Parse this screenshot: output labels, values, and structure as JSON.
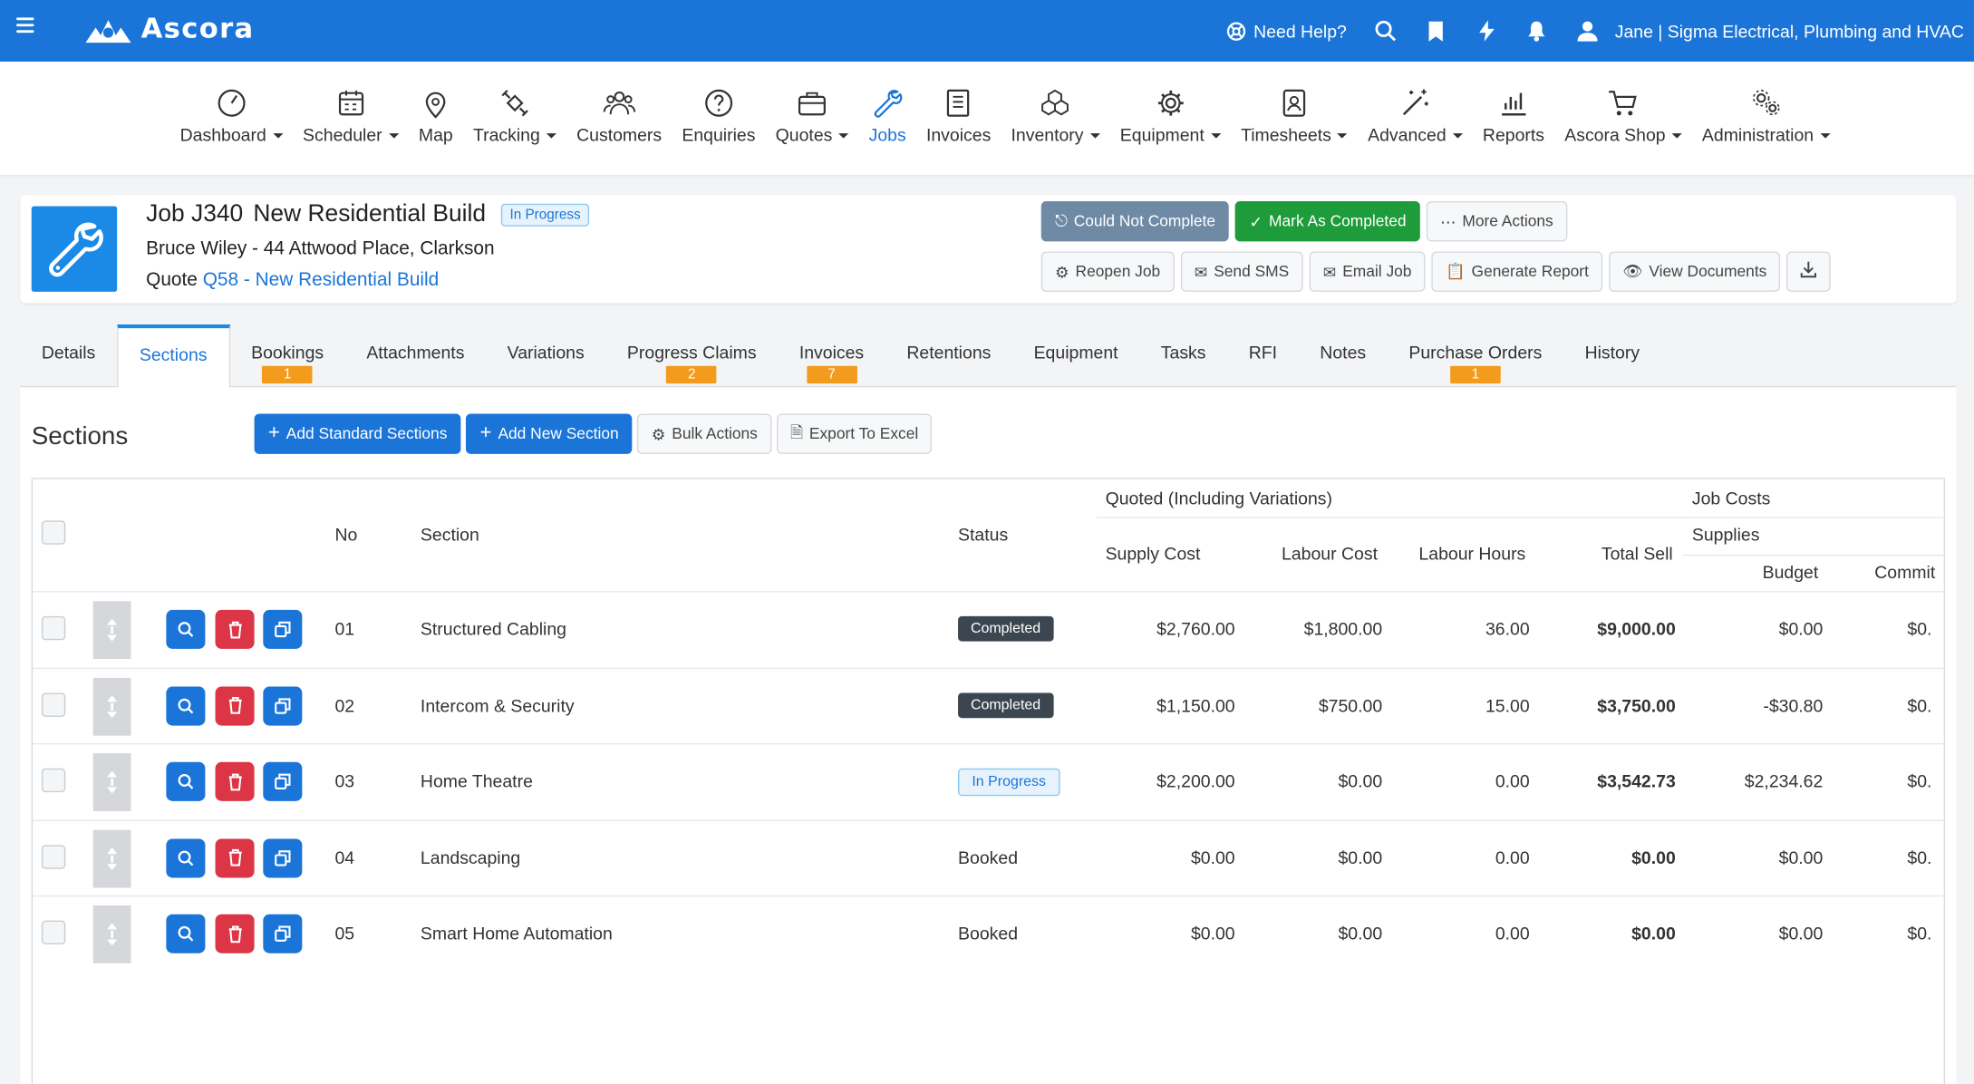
{
  "app": {
    "brand": "Ascora",
    "accent": "#1b75d9"
  },
  "topbar": {
    "help": "Need Help?",
    "user": "Jane | Sigma Electrical, Plumbing and HVAC"
  },
  "nav": [
    {
      "label": "Dashboard",
      "icon": "gauge-icon",
      "dropdown": true
    },
    {
      "label": "Scheduler",
      "icon": "calendar-icon",
      "dropdown": true
    },
    {
      "label": "Map",
      "icon": "map-pin-icon",
      "dropdown": false
    },
    {
      "label": "Tracking",
      "icon": "satellite-icon",
      "dropdown": true
    },
    {
      "label": "Customers",
      "icon": "people-icon",
      "dropdown": false
    },
    {
      "label": "Enquiries",
      "icon": "question-icon",
      "dropdown": false
    },
    {
      "label": "Quotes",
      "icon": "briefcase-icon",
      "dropdown": true
    },
    {
      "label": "Jobs",
      "icon": "wrench-icon",
      "dropdown": false,
      "active": true
    },
    {
      "label": "Invoices",
      "icon": "invoice-icon",
      "dropdown": false
    },
    {
      "label": "Inventory",
      "icon": "boxes-icon",
      "dropdown": true
    },
    {
      "label": "Equipment",
      "icon": "gear-icon",
      "dropdown": true
    },
    {
      "label": "Timesheets",
      "icon": "id-badge-icon",
      "dropdown": true
    },
    {
      "label": "Advanced",
      "icon": "magic-wand-icon",
      "dropdown": true
    },
    {
      "label": "Reports",
      "icon": "bar-chart-icon",
      "dropdown": false
    },
    {
      "label": "Ascora Shop",
      "icon": "cart-icon",
      "dropdown": true
    },
    {
      "label": "Administration",
      "icon": "gears-icon",
      "dropdown": true
    }
  ],
  "job": {
    "number": "Job J340",
    "name": "New Residential Build",
    "status": "In Progress",
    "customer": "Bruce Wiley - 44 Attwood Place, Clarkson",
    "quote_prefix": "Quote",
    "quote_link": "Q58 - New Residential Build"
  },
  "actions": {
    "could_not_complete": "Could Not Complete",
    "mark_completed": "Mark As Completed",
    "more_actions": "More Actions",
    "reopen": "Reopen Job",
    "send_sms": "Send SMS",
    "email_job": "Email Job",
    "generate_report": "Generate Report",
    "view_documents": "View Documents"
  },
  "tabs": [
    {
      "label": "Details"
    },
    {
      "label": "Sections",
      "active": true
    },
    {
      "label": "Bookings",
      "count": "1"
    },
    {
      "label": "Attachments"
    },
    {
      "label": "Variations"
    },
    {
      "label": "Progress Claims",
      "count": "2"
    },
    {
      "label": "Invoices",
      "count": "7"
    },
    {
      "label": "Retentions"
    },
    {
      "label": "Equipment"
    },
    {
      "label": "Tasks"
    },
    {
      "label": "RFI"
    },
    {
      "label": "Notes"
    },
    {
      "label": "Purchase Orders",
      "count": "1"
    },
    {
      "label": "History"
    }
  ],
  "sections_panel": {
    "title": "Sections",
    "add_standard": "Add Standard Sections",
    "add_new": "Add New Section",
    "bulk_actions": "Bulk Actions",
    "export_excel": "Export To Excel"
  },
  "grid_headers": {
    "no": "No",
    "section": "Section",
    "status": "Status",
    "quoted_group": "Quoted (Including Variations)",
    "job_costs_group": "Job Costs",
    "supplies_group": "Supplies",
    "supply_cost": "Supply Cost",
    "labour_cost": "Labour Cost",
    "labour_hours": "Labour Hours",
    "total_sell": "Total Sell",
    "budget": "Budget",
    "committed": "Commit"
  },
  "rows": [
    {
      "no": "01",
      "section": "Structured Cabling",
      "status": "Completed",
      "status_type": "done",
      "supply_cost": "$2,760.00",
      "labour_cost": "$1,800.00",
      "labour_hours": "36.00",
      "total_sell": "$9,000.00",
      "budget": "$0.00",
      "committed": "$0."
    },
    {
      "no": "02",
      "section": "Intercom & Security",
      "status": "Completed",
      "status_type": "done",
      "supply_cost": "$1,150.00",
      "labour_cost": "$750.00",
      "labour_hours": "15.00",
      "total_sell": "$3,750.00",
      "budget": "-$30.80",
      "committed": "$0."
    },
    {
      "no": "03",
      "section": "Home Theatre",
      "status": "In Progress",
      "status_type": "ip",
      "supply_cost": "$2,200.00",
      "labour_cost": "$0.00",
      "labour_hours": "0.00",
      "total_sell": "$3,542.73",
      "budget": "$2,234.62",
      "committed": "$0."
    },
    {
      "no": "04",
      "section": "Landscaping",
      "status": "Booked",
      "status_type": "plain",
      "supply_cost": "$0.00",
      "labour_cost": "$0.00",
      "labour_hours": "0.00",
      "total_sell": "$0.00",
      "budget": "$0.00",
      "committed": "$0."
    },
    {
      "no": "05",
      "section": "Smart Home Automation",
      "status": "Booked",
      "status_type": "plain",
      "supply_cost": "$0.00",
      "labour_cost": "$0.00",
      "labour_hours": "0.00",
      "total_sell": "$0.00",
      "budget": "$0.00",
      "committed": "$0."
    }
  ]
}
